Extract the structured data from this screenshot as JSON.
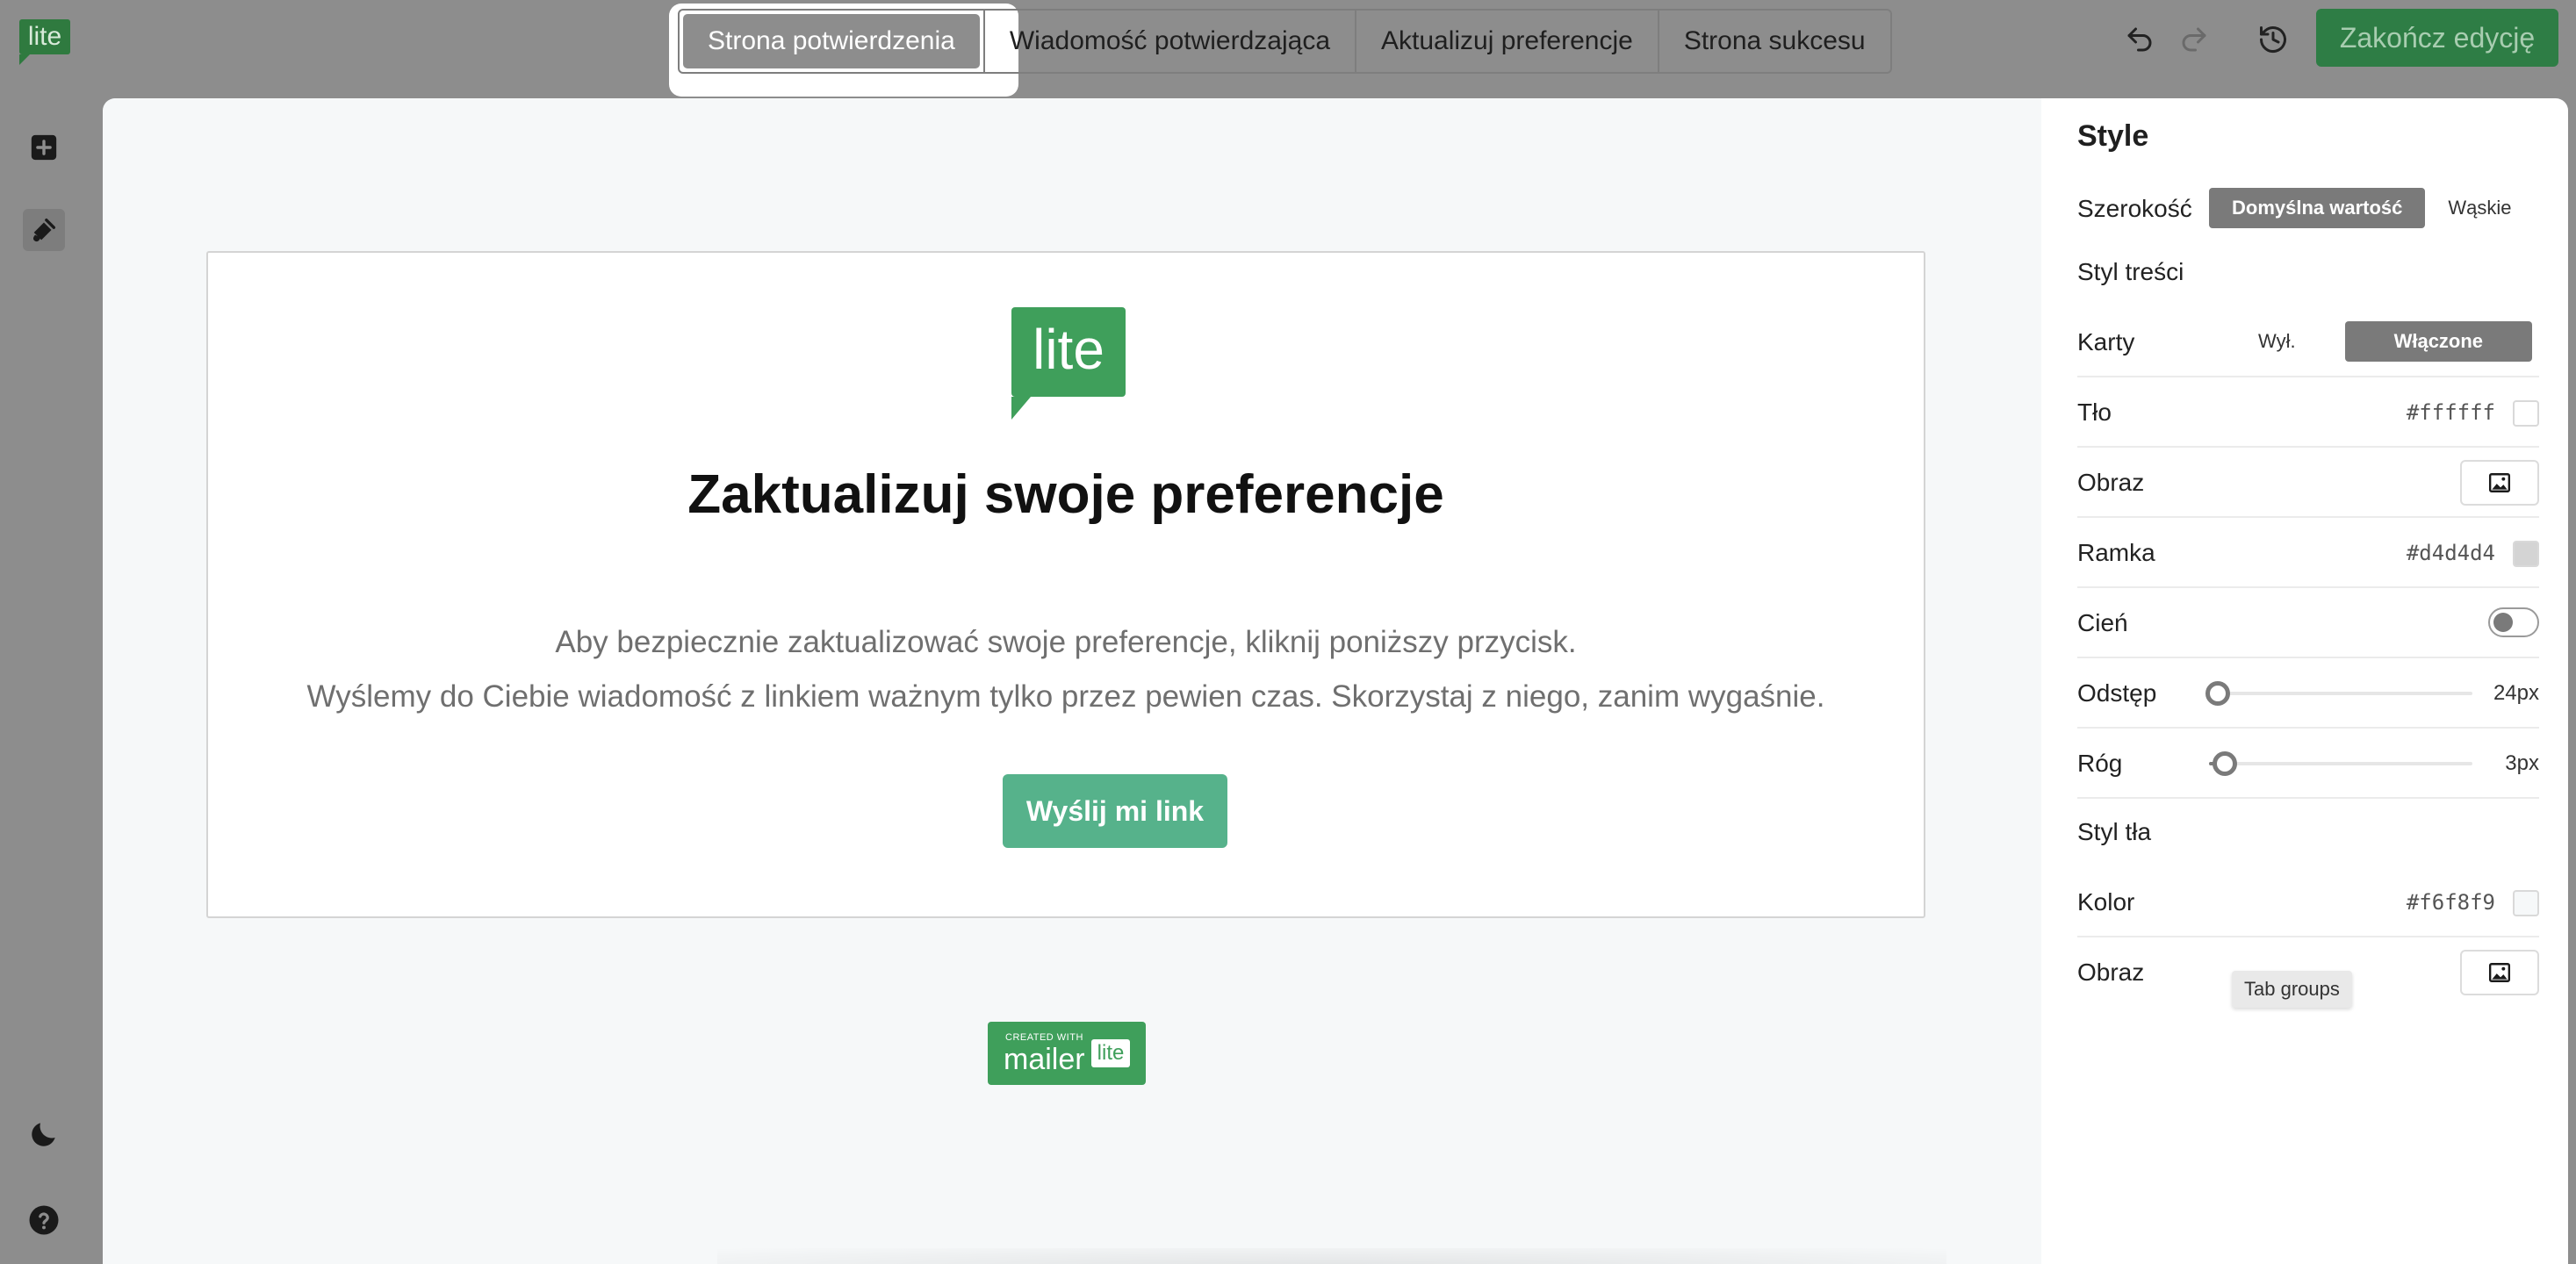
{
  "app": {
    "logo_text": "lite"
  },
  "tabs": [
    {
      "label": "Strona potwierdzenia",
      "active": true
    },
    {
      "label": "Wiadomość potwierdzająca",
      "active": false
    },
    {
      "label": "Aktualizuj preferencje",
      "active": false
    },
    {
      "label": "Strona sukcesu",
      "active": false
    }
  ],
  "toolbar": {
    "undo_icon": "undo-icon",
    "redo_icon": "redo-icon",
    "history_icon": "history-icon",
    "finish_label": "Zakończ edycję",
    "finish_color": "#2e7d45"
  },
  "rail": {
    "top_icons": [
      "add-block-icon",
      "paint-icon"
    ],
    "bottom_icons": [
      "moon-icon",
      "help-icon"
    ]
  },
  "canvas": {
    "logo_text": "lite",
    "title": "Zaktualizuj swoje preferencje",
    "line1": "Aby bezpiecznie zaktualizować swoje preferencje, kliknij poniższy przycisk.",
    "line2": "Wyślemy do Ciebie wiadomość z linkiem ważnym tylko przez pewien czas. Skorzystaj z niego, zanim wygaśnie.",
    "button_label": "Wyślij mi link",
    "button_color": "#56b28b",
    "badge_small": "CREATED WITH",
    "badge_big": "mailer",
    "badge_box": "lite"
  },
  "panel": {
    "title": "Style",
    "width_label": "Szerokość",
    "width_options": [
      "Domyślna wartość",
      "Wąskie"
    ],
    "width_selected": "Domyślna wartość",
    "content_style_label": "Styl treści",
    "cards_label": "Karty",
    "cards_options": [
      "Wył.",
      "Włączone"
    ],
    "cards_selected": "Włączone",
    "background_label": "Tło",
    "background_value": "#ffffff",
    "image_label": "Obraz",
    "border_label": "Ramka",
    "border_value": "#d4d4d4",
    "shadow_label": "Cień",
    "shadow_on": false,
    "spacing_label": "Odstęp",
    "spacing_value": "24px",
    "corner_label": "Róg",
    "corner_value": "3px",
    "bg_style_label": "Styl tła",
    "color_label": "Kolor",
    "color_value": "#f6f8f9",
    "image2_label": "Obraz"
  },
  "tooltip": {
    "text": "Tab groups"
  }
}
